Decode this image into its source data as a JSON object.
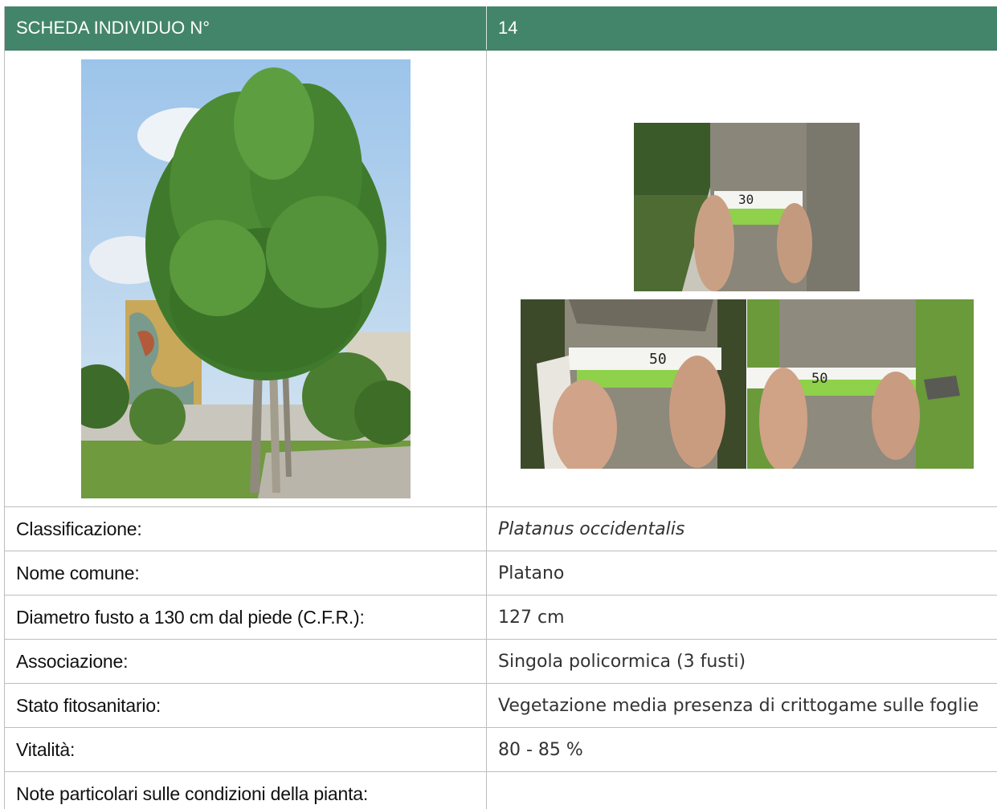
{
  "header": {
    "title": "SCHEDA INDIVIDUO N°",
    "number": "14"
  },
  "rows": [
    {
      "label": "Classificazione:",
      "value": "Platanus occidentalis"
    },
    {
      "label": "Nome comune:",
      "value": "Platano"
    },
    {
      "label": "Diametro fusto a 130 cm dal piede (C.F.R.):",
      "value": "127 cm"
    },
    {
      "label": "Associazione:",
      "value": "Singola policormica (3 fusti)"
    },
    {
      "label": "Stato fitosanitario:",
      "value": "Vegetazione media presenza di crittogame sulle foglie"
    },
    {
      "label": "Vitalità:",
      "value": "80 - 85 %"
    },
    {
      "label": "Note particolari sulle condizioni della pianta:",
      "value": ""
    }
  ],
  "photos": {
    "tree": {
      "description_icon": "tree-photo"
    },
    "tape_measure_numbers": [
      "30",
      "50",
      "50"
    ]
  },
  "colors": {
    "header_bg": "#43856a",
    "header_text": "#ffffff",
    "grid": "#bdbdbd"
  }
}
